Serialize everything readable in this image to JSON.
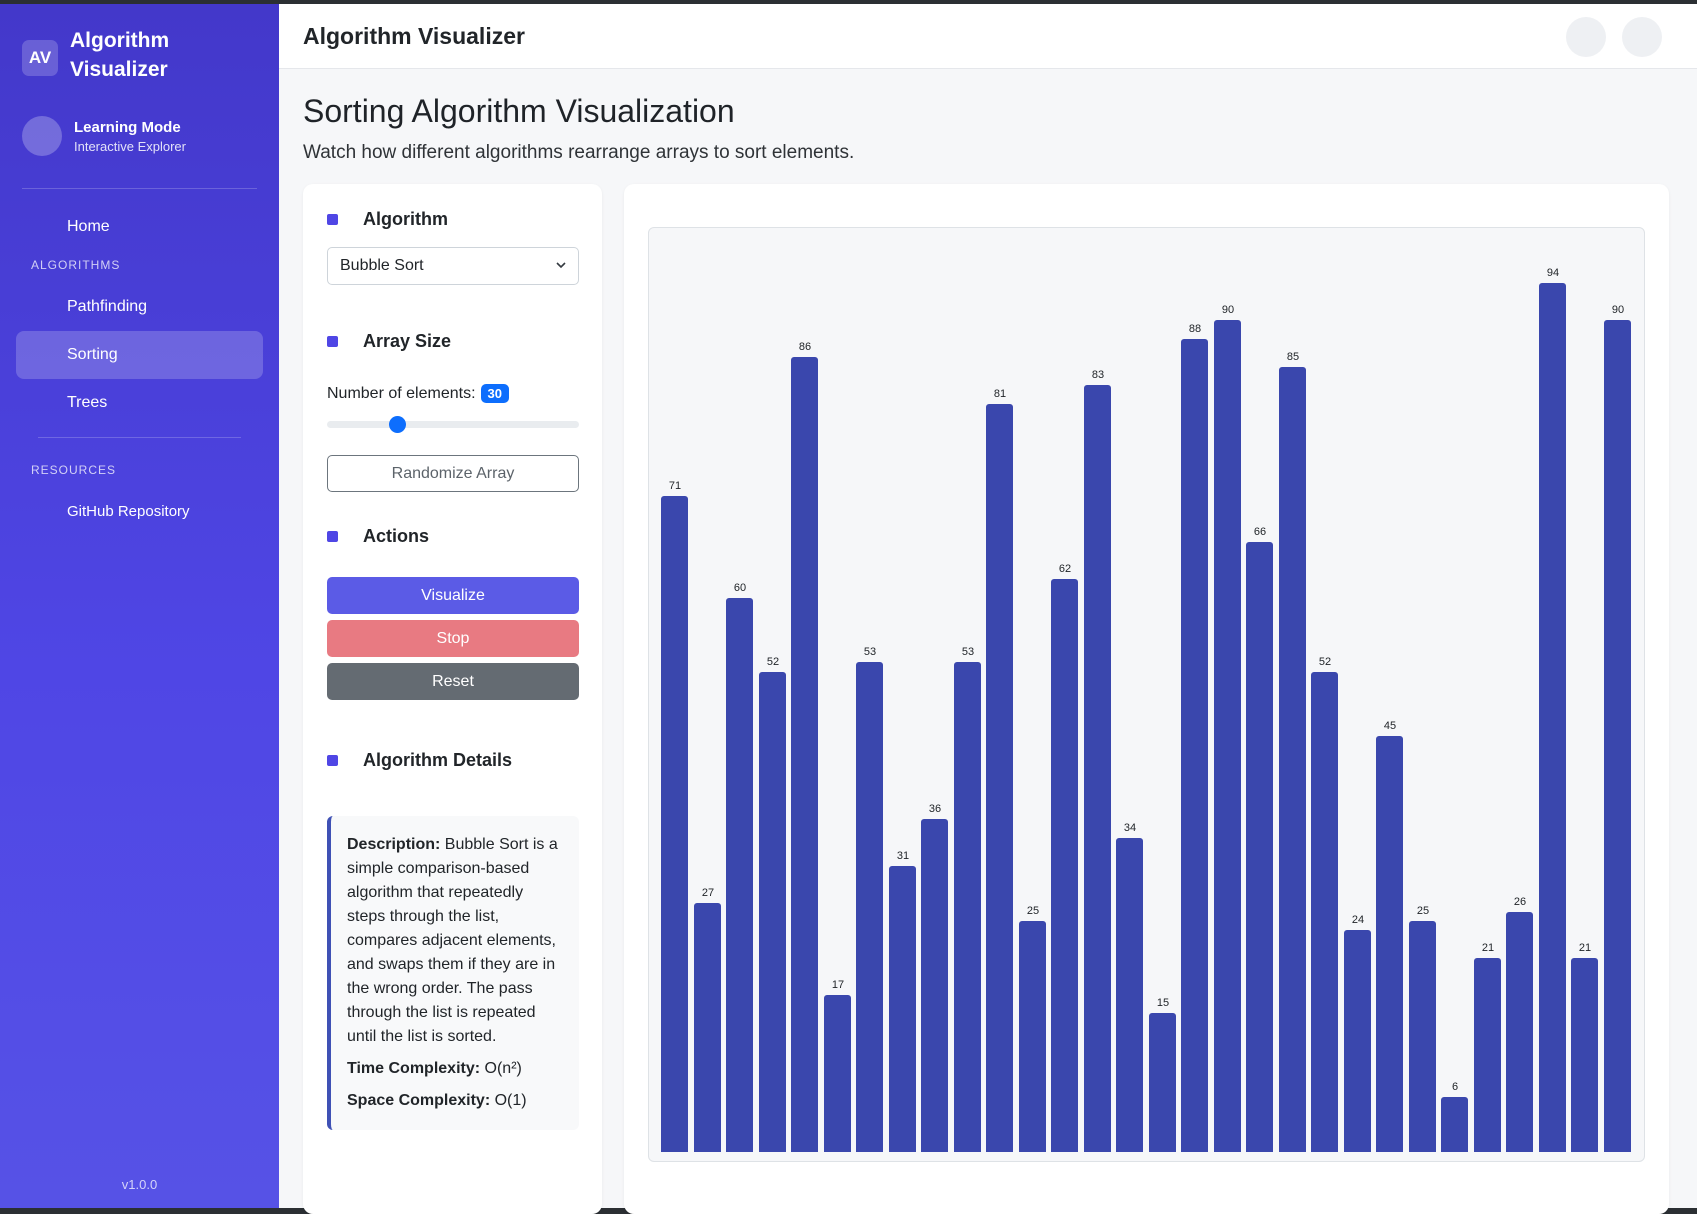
{
  "brand": {
    "logo": "AV",
    "title": "Algorithm Visualizer"
  },
  "user": {
    "name": "Learning Mode",
    "subtitle": "Interactive Explorer"
  },
  "nav": {
    "home": "Home",
    "algorithms_section": "ALGORITHMS",
    "pathfinding": "Pathfinding",
    "sorting": "Sorting",
    "trees": "Trees",
    "resources_section": "RESOURCES",
    "github": "GitHub Repository"
  },
  "version": "v1.0.0",
  "topbar": {
    "title": "Algorithm Visualizer"
  },
  "page": {
    "title": "Sorting Algorithm Visualization",
    "subtitle": "Watch how different algorithms rearrange arrays to sort elements."
  },
  "controls": {
    "algorithm_heading": "Algorithm",
    "algorithm_selected": "Bubble Sort",
    "array_size_heading": "Array Size",
    "size_label": "Number of elements:",
    "size_value": "30",
    "slider_min": 5,
    "slider_max": 100,
    "slider_value": 30,
    "randomize_label": "Randomize Array",
    "actions_heading": "Actions",
    "visualize_label": "Visualize",
    "stop_label": "Stop",
    "reset_label": "Reset",
    "details_heading": "Algorithm Details",
    "description_label": "Description:",
    "description_text": "Bubble Sort is a simple comparison-based algorithm that repeatedly steps through the list, compares adjacent elements, and swaps them if they are in the wrong order. The pass through the list is repeated until the list is sorted.",
    "time_label": "Time Complexity:",
    "time_value": "O(n²)",
    "space_label": "Space Complexity:",
    "space_value": "O(1)"
  },
  "colors": {
    "accent": "#4f46e5",
    "bar": "#3a47ad",
    "primary_button": "#5b5be6",
    "danger_button": "#e87a82",
    "secondary_button": "#646b72",
    "badge": "#0d6efd"
  },
  "chart_data": {
    "type": "bar",
    "values": [
      71,
      27,
      60,
      52,
      86,
      17,
      53,
      31,
      36,
      53,
      81,
      25,
      62,
      83,
      34,
      15,
      88,
      90,
      66,
      85,
      52,
      24,
      45,
      25,
      6,
      21,
      26,
      94,
      21,
      90
    ],
    "ylim": [
      0,
      100
    ],
    "grid": false
  }
}
